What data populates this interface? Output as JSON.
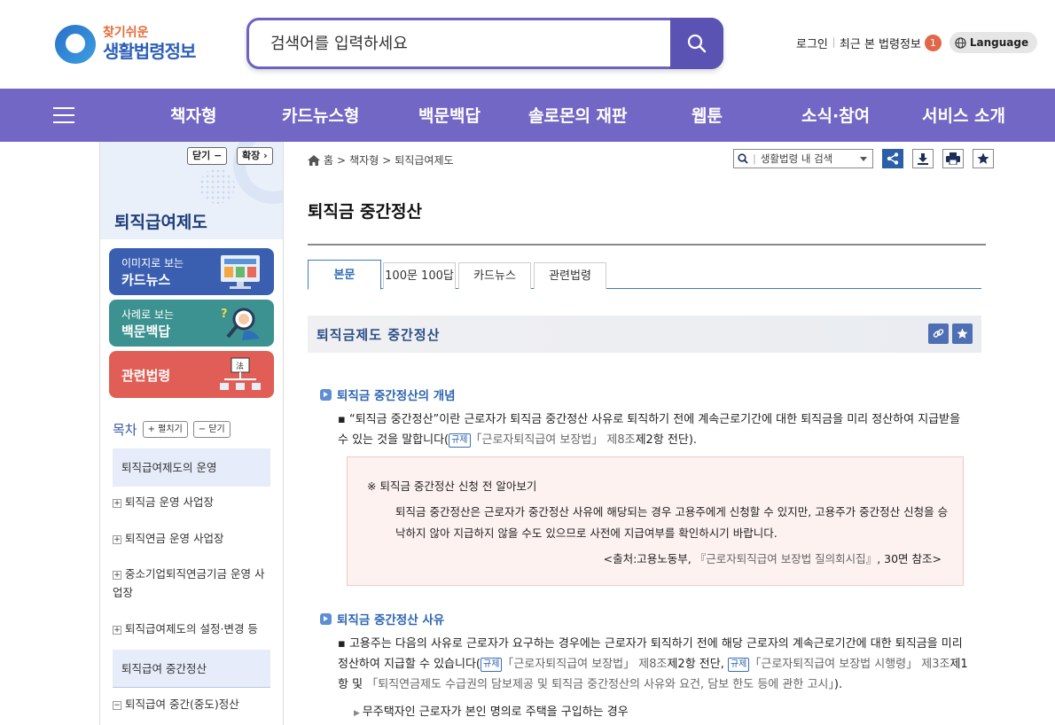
{
  "header": {
    "logo_top": "찾기쉬운",
    "logo_bottom": "생활법령정보",
    "search_placeholder": "검색어를 입력하세요",
    "login": "로그인",
    "recent": "최근 본 법령정보",
    "recent_count": "1",
    "language": "Language"
  },
  "gnb": {
    "items": [
      "책자형",
      "카드뉴스형",
      "백문백답",
      "솔로몬의 재판",
      "웹툰",
      "소식·참여",
      "서비스 소개"
    ]
  },
  "sidebar": {
    "close_label": "닫기",
    "expand_label": "확장",
    "title": "퇴직급여제도",
    "card_news_l1": "이미지로 보는",
    "card_news_l2": "카드뉴스",
    "qa_l1": "사례로 보는",
    "qa_l2": "백문백답",
    "related_law": "관련법령",
    "toc_label": "목차",
    "toc_expand": "펼치기",
    "toc_close": "닫기",
    "toc": [
      "퇴직급여제도의 운영",
      "퇴직금 운영 사업장",
      "퇴직연금 운영 사업장",
      "중소기업퇴직연금기금 운영 사업장",
      "퇴직급여제도의 설정·변경 등",
      "퇴직급여 중간정산",
      "퇴직급여 중간(중도)정산"
    ]
  },
  "main": {
    "breadcrumb": [
      "홈",
      "책자형",
      "퇴직급여제도"
    ],
    "site_search": "생활법령 내 검색",
    "title": "퇴직금 중간정산",
    "tabs": [
      "본문",
      "100문 100답",
      "카드뉴스",
      "관련법령"
    ],
    "section_title": "퇴직금제도 중간정산",
    "h1": "퇴직금 중간정산의 개념",
    "p1a": "“퇴직금 중간정산”이란 근로자가 퇴직금 중간정산 사유로 퇴직하기 전에 계속근로기간에 대한 퇴직금을 미리 정산하여 지급받을 수 있는 것을 말합니다(",
    "law_tag": "규제",
    "p1_law": "「근로자퇴직급여 보장법」 제8조",
    "p1b": "제2항 전단).",
    "note_title": "※ 퇴직금 중간정산 신청 전 알아보기",
    "note_body": "퇴직금 중간정산은 근로자가 중간정산 사유에 해당되는 경우 고용주에게 신청할 수 있지만, 고용주가 중간정산 신청을 승낙하지 않아 지급하지 않을 수도 있으므로 사전에 지급여부를 확인하시기 바랍니다.",
    "note_src_a": "<출처:고용노동부, ",
    "note_src_book": "『근로자퇴직급여 보장법 질의회시집』",
    "note_src_b": ", 30면 참조>",
    "h2": "퇴직금 중간정산 사유",
    "p2a": "고용주는 다음의 사유로 근로자가 요구하는 경우에는 근로자가 퇴직하기 전에 해당 근로자의 계속근로기간에 대한 퇴직금을 미리 정산하여 지급할 수 있습니다(",
    "p2_law1": "「근로자퇴직급여 보장법」 제8조",
    "p2b": "제2항 전단, ",
    "p2_law2": "「근로자퇴직급여 보장법 시행령」 제3조",
    "p2c": "제1항 및 ",
    "p2_law3": "「퇴직연금제도 수급권의 담보제공 및 퇴직금 중간정산의 사유와 요건, 담보 한도 등에 관한 고시」",
    "p2d": ").",
    "item1": "무주택자인 근로자가 본인 명의로 주택을 구입하는 경우"
  },
  "colors": {
    "gnb": "#7367c5",
    "search_border": "#6b62c4",
    "accent_blue": "#2d65b1",
    "card_news": "#3a5fb0",
    "card_qa": "#3c9290",
    "card_law": "#e05e55"
  }
}
